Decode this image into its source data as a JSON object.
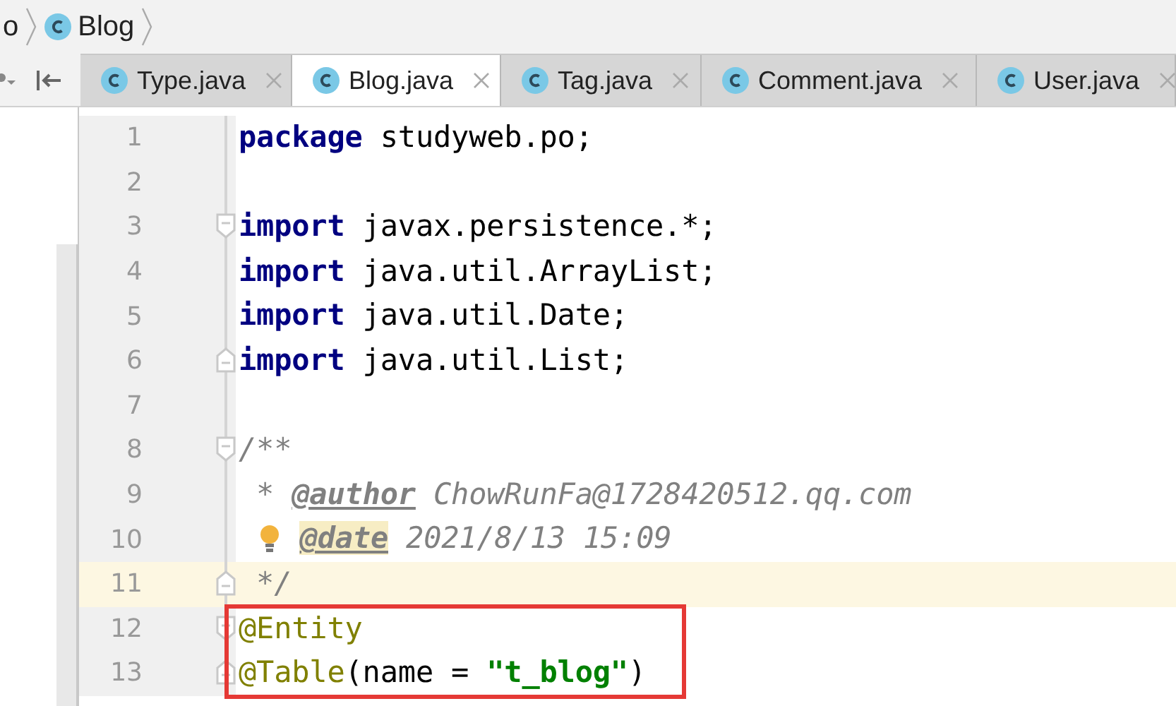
{
  "breadcrumb": [
    {
      "text": "o",
      "class_icon": false
    },
    {
      "text": "Blog",
      "class_icon": true
    }
  ],
  "tabs": [
    {
      "label": "Type.java",
      "selected": false
    },
    {
      "label": "Blog.java",
      "selected": true
    },
    {
      "label": "Tag.java",
      "selected": false
    },
    {
      "label": "Comment.java",
      "selected": false
    },
    {
      "label": "User.java",
      "selected": false
    }
  ],
  "lines": [
    {
      "number": "1",
      "current": false,
      "fold_start": false,
      "fold_end": false,
      "boxed": false,
      "bulb": false,
      "tokens": [
        {
          "kind": "keyword",
          "text": "package"
        },
        {
          "kind": "plain",
          "text": " studyweb.po;"
        }
      ]
    },
    {
      "number": "2",
      "current": false,
      "fold_start": false,
      "fold_end": false,
      "boxed": false,
      "bulb": false
    },
    {
      "number": "3",
      "current": false,
      "fold_start": true,
      "fold_end": false,
      "boxed": false,
      "bulb": false,
      "tokens": [
        {
          "kind": "keyword",
          "text": "import"
        },
        {
          "kind": "plain",
          "text": " javax.persistence.*;"
        }
      ]
    },
    {
      "number": "4",
      "current": false,
      "fold_start": false,
      "fold_end": false,
      "boxed": false,
      "bulb": false,
      "tokens": [
        {
          "kind": "keyword",
          "text": "import"
        },
        {
          "kind": "plain",
          "text": " java.util.ArrayList;"
        }
      ]
    },
    {
      "number": "5",
      "current": false,
      "fold_start": false,
      "fold_end": false,
      "boxed": false,
      "bulb": false,
      "tokens": [
        {
          "kind": "keyword",
          "text": "import"
        },
        {
          "kind": "plain",
          "text": " java.util.Date;"
        }
      ]
    },
    {
      "number": "6",
      "current": false,
      "fold_start": false,
      "fold_end": true,
      "boxed": false,
      "bulb": false,
      "tokens": [
        {
          "kind": "keyword",
          "text": "import"
        },
        {
          "kind": "plain",
          "text": " java.util.List;"
        }
      ]
    },
    {
      "number": "7",
      "current": false,
      "fold_start": false,
      "fold_end": false,
      "boxed": false,
      "bulb": false
    },
    {
      "number": "8",
      "current": false,
      "fold_start": true,
      "fold_end": false,
      "boxed": false,
      "bulb": false,
      "tokens": [
        {
          "kind": "comment",
          "text": "/**"
        }
      ]
    },
    {
      "number": "9",
      "current": false,
      "fold_start": false,
      "fold_end": false,
      "boxed": false,
      "bulb": false,
      "tokens": [
        {
          "kind": "comment",
          "text": " * "
        },
        {
          "kind": "doctag",
          "text": "@author",
          "highlighted": false
        },
        {
          "kind": "comment",
          "text": " ChowRunFa@1728420512.qq.com"
        }
      ]
    },
    {
      "number": "10",
      "current": false,
      "fold_start": false,
      "fold_end": false,
      "boxed": false,
      "bulb": true,
      "tokens": [
        {
          "kind": "doctag",
          "text": "@date",
          "highlighted": true
        },
        {
          "kind": "comment",
          "text": " 2021/8/13 15:09"
        }
      ]
    },
    {
      "number": "11",
      "current": true,
      "fold_start": false,
      "fold_end": true,
      "boxed": false,
      "bulb": false,
      "tokens": [
        {
          "kind": "comment",
          "text": " */"
        }
      ]
    },
    {
      "number": "12",
      "current": false,
      "fold_start": true,
      "fold_end": false,
      "boxed": true,
      "bulb": false,
      "tokens": [
        {
          "kind": "annotation",
          "text": "@Entity"
        }
      ]
    },
    {
      "number": "13",
      "current": false,
      "fold_start": false,
      "fold_end": true,
      "boxed": true,
      "bulb": false,
      "tokens": [
        {
          "kind": "annotation",
          "text": "@Table"
        },
        {
          "kind": "plain",
          "text": "(name = "
        },
        {
          "kind": "string",
          "text": "\"t_blog\""
        },
        {
          "kind": "plain",
          "text": ")"
        }
      ]
    }
  ]
}
